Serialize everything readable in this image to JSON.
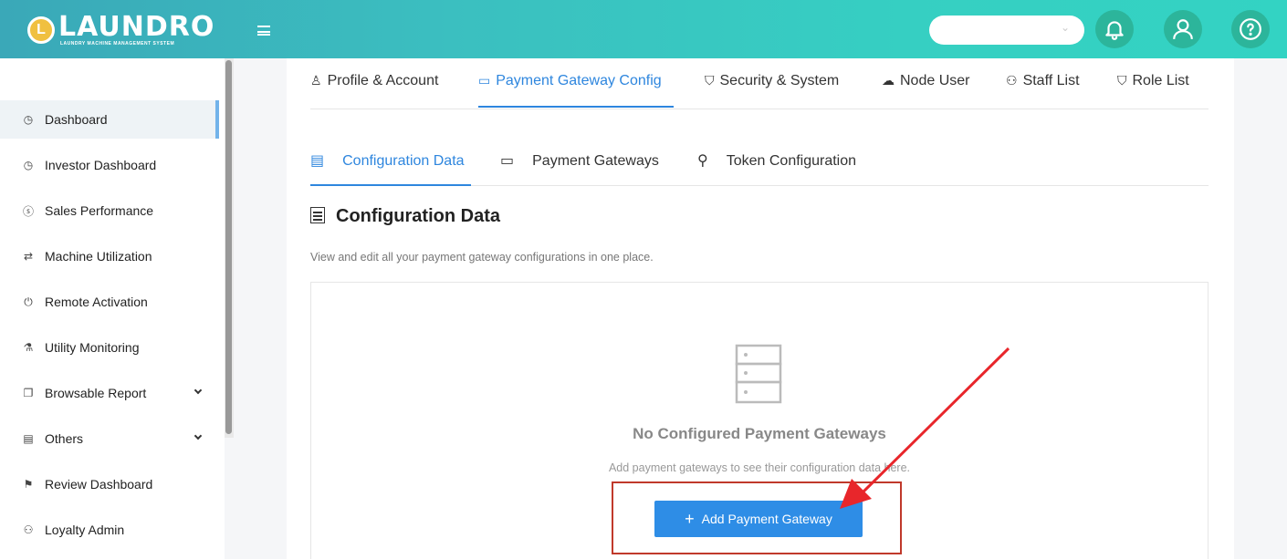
{
  "header": {
    "logo_badge": "L",
    "logo_text": "LAUNDRO",
    "logo_subtitle": "LAUNDRY MACHINE MANAGEMENT SYSTEM",
    "search_select_value": "",
    "icons": [
      "menu-icon",
      "bell-icon",
      "user-icon",
      "help-icon"
    ]
  },
  "sidebar": {
    "items": [
      {
        "label": "Dashboard",
        "icon": "gauge-icon",
        "glyph": "◷"
      },
      {
        "label": "Investor Dashboard",
        "icon": "gauge-icon",
        "glyph": "◷"
      },
      {
        "label": "Sales Performance",
        "icon": "dollar-icon",
        "glyph": "ⓢ"
      },
      {
        "label": "Machine Utilization",
        "icon": "swap-icon",
        "glyph": "⇄"
      },
      {
        "label": "Remote Activation",
        "icon": "power-icon",
        "glyph": "⏻"
      },
      {
        "label": "Utility Monitoring",
        "icon": "flask-icon",
        "glyph": "⚗"
      },
      {
        "label": "Browsable Report",
        "icon": "copy-icon",
        "glyph": "❐"
      },
      {
        "label": "Others",
        "icon": "book-icon",
        "glyph": "▤"
      },
      {
        "label": "Review Dashboard",
        "icon": "flag-icon",
        "glyph": "⚑"
      },
      {
        "label": "Loyalty Admin",
        "icon": "users-icon",
        "glyph": "⚇"
      }
    ]
  },
  "top_tabs": [
    {
      "label": "Profile & Account",
      "glyph": "♙"
    },
    {
      "label": "Payment Gateway Config",
      "glyph": "▭"
    },
    {
      "label": "Security & System",
      "glyph": "⛉"
    },
    {
      "label": "Node User",
      "glyph": "☁"
    },
    {
      "label": "Staff List",
      "glyph": "⚇"
    },
    {
      "label": "Role List",
      "glyph": "⛉"
    }
  ],
  "sub_tabs": [
    {
      "label": "Configuration Data",
      "glyph": "▤"
    },
    {
      "label": "Payment Gateways",
      "glyph": "▭"
    },
    {
      "label": "Token Configuration",
      "glyph": "⚲"
    }
  ],
  "section": {
    "title": "Configuration Data",
    "description": "View and edit all your payment gateway configurations in one place."
  },
  "empty_state": {
    "title": "No Configured Payment Gateways",
    "description": "Add payment gateways to see their configuration data here.",
    "button_label": "Add Payment Gateway",
    "button_plus": "+"
  },
  "colors": {
    "header_start": "#3aa8b8",
    "header_end": "#33d3c3",
    "accent": "#2e86de",
    "button": "#2e8de6",
    "annotation": "#e8262b"
  }
}
